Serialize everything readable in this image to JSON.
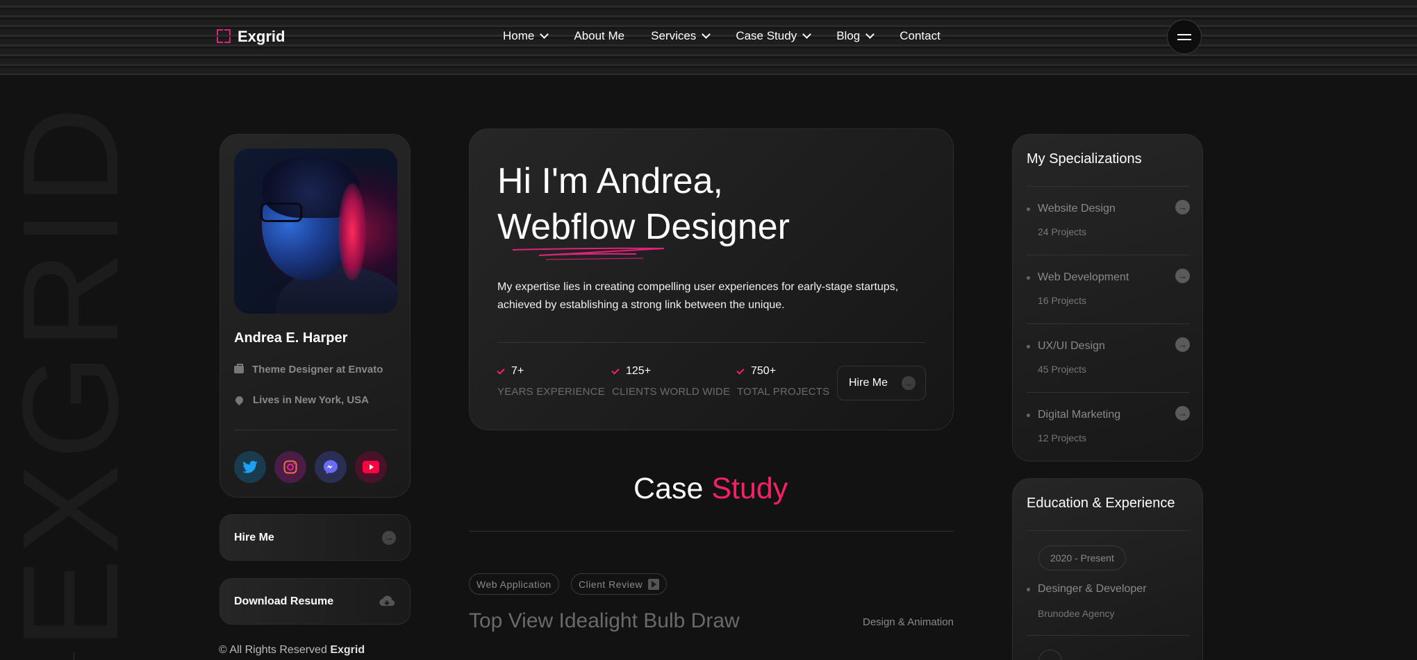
{
  "brand": {
    "name": "Exgrid",
    "accent": "#ff1f68"
  },
  "nav": {
    "items": [
      {
        "label": "Home",
        "dropdown": true
      },
      {
        "label": "About Me",
        "dropdown": false
      },
      {
        "label": "Services",
        "dropdown": true
      },
      {
        "label": "Case Study",
        "dropdown": true
      },
      {
        "label": "Blog",
        "dropdown": true
      },
      {
        "label": "Contact",
        "dropdown": false
      }
    ]
  },
  "watermark": "EXGRID",
  "profile": {
    "name": "Andrea E. Harper",
    "job": "Theme Designer at Envato",
    "location": "Lives in New York, USA",
    "socials": [
      "twitter-icon",
      "instagram-icon",
      "messenger-icon",
      "youtube-icon"
    ]
  },
  "buttons": {
    "hire": "Hire Me",
    "resume": "Download Resume"
  },
  "footer": {
    "copyright_prefix": "© All Rights Reserved",
    "copyright_brand": "Exgrid"
  },
  "hero": {
    "line1": "Hi I'm Andrea,",
    "line2": "Webflow Designer",
    "lead": "My expertise lies in creating compelling user experiences for early-stage startups, achieved by establishing a strong link between the unique.",
    "stats": [
      {
        "value": "7+",
        "label": "YEARS EXPERIENCE"
      },
      {
        "value": "125+",
        "label": "CLIENTS WORLD WIDE"
      },
      {
        "value": "750+",
        "label": "TOTAL PROJECTS"
      }
    ],
    "hire": "Hire Me"
  },
  "case_study": {
    "title_a": "Case",
    "title_b": "Study",
    "tags": [
      "Web Application",
      "Client Review"
    ],
    "project_title": "Top View Idealight Bulb Draw",
    "project_category": "Design & Animation"
  },
  "specializations": {
    "title": "My Specializations",
    "items": [
      {
        "name": "Website Design",
        "count": "24 Projects"
      },
      {
        "name": "Web Development",
        "count": "16 Projects"
      },
      {
        "name": "UX/UI Design",
        "count": "45 Projects"
      },
      {
        "name": "Digital Marketing",
        "count": "12 Projects"
      }
    ]
  },
  "education": {
    "title": "Education & Experience",
    "items": [
      {
        "period": "2020 - Present",
        "role": "Desinger & Developer",
        "org": "Brunodee Agency"
      }
    ]
  }
}
